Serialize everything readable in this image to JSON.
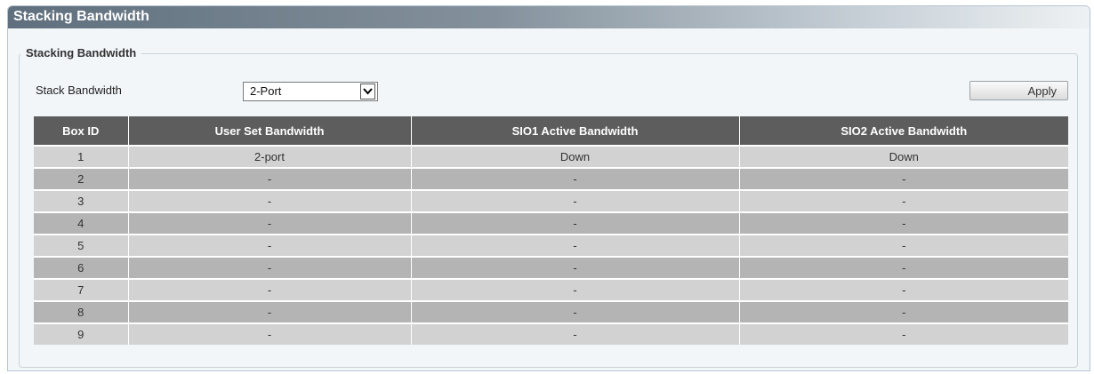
{
  "panel": {
    "title": "Stacking Bandwidth"
  },
  "form": {
    "legend": "Stacking Bandwidth",
    "bandwidth_label": "Stack Bandwidth",
    "bandwidth_value": "2-Port",
    "apply_label": "Apply"
  },
  "table": {
    "headers": [
      "Box ID",
      "User Set Bandwidth",
      "SIO1 Active Bandwidth",
      "SIO2 Active Bandwidth"
    ],
    "rows": [
      [
        "1",
        "2-port",
        "Down",
        "Down"
      ],
      [
        "2",
        "-",
        "-",
        "-"
      ],
      [
        "3",
        "-",
        "-",
        "-"
      ],
      [
        "4",
        "-",
        "-",
        "-"
      ],
      [
        "5",
        "-",
        "-",
        "-"
      ],
      [
        "6",
        "-",
        "-",
        "-"
      ],
      [
        "7",
        "-",
        "-",
        "-"
      ],
      [
        "8",
        "-",
        "-",
        "-"
      ],
      [
        "9",
        "-",
        "-",
        "-"
      ]
    ]
  },
  "colors": {
    "header_bg": "#5d5d5d",
    "row_light": "#d2d2d2",
    "row_dark": "#b4b4b4"
  }
}
